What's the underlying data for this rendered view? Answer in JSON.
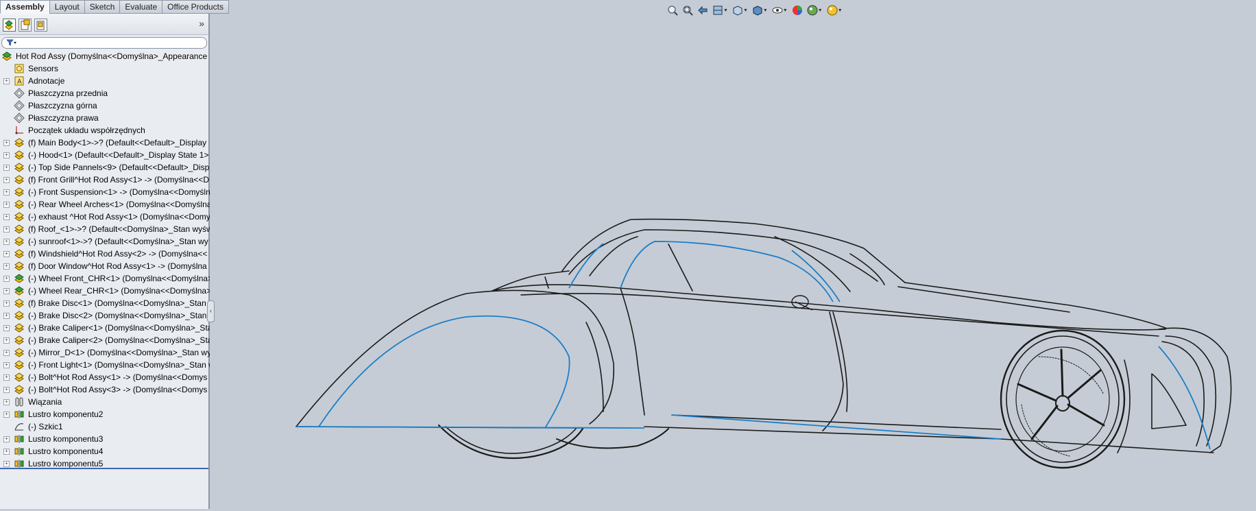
{
  "command_tabs": [
    "Assembly",
    "Layout",
    "Sketch",
    "Evaluate",
    "Office Products"
  ],
  "feature_tree": [
    {
      "label": "Hot Rod Assy  (Domyślna<<Domyślna>_Appearance D",
      "icon": "assembly-icon",
      "expand": false,
      "root": true
    },
    {
      "label": "Sensors",
      "icon": "sensors-icon",
      "expand": false
    },
    {
      "label": "Adnotacje",
      "icon": "annotations-icon",
      "expand": true
    },
    {
      "label": "Płaszczyzna przednia",
      "icon": "plane-icon",
      "expand": false
    },
    {
      "label": "Płaszczyzna górna",
      "icon": "plane-icon",
      "expand": false
    },
    {
      "label": "Płaszczyzna prawa",
      "icon": "plane-icon",
      "expand": false
    },
    {
      "label": "Początek układu współrzędnych",
      "icon": "origin-icon",
      "expand": false
    },
    {
      "label": "(f) Main Body<1>->? (Default<<Default>_Display",
      "icon": "subassembly-icon",
      "expand": true
    },
    {
      "label": "(-) Hood<1> (Default<<Default>_Display State 1>",
      "icon": "subassembly-icon",
      "expand": true
    },
    {
      "label": "(-) Top Side Pannels<9> (Default<<Default>_Displ",
      "icon": "subassembly-icon",
      "expand": true
    },
    {
      "label": "(f) Front Grill^Hot Rod Assy<1> -> (Domyślna<<D",
      "icon": "subassembly-icon",
      "expand": true
    },
    {
      "label": "(-) Front Suspension<1> -> (Domyślna<<Domyśln",
      "icon": "subassembly-icon",
      "expand": true
    },
    {
      "label": "(-) Rear Wheel Arches<1> (Domyślna<<Domyślna",
      "icon": "subassembly-icon",
      "expand": true
    },
    {
      "label": "(-) exhaust ^Hot Rod Assy<1> (Domyślna<<Domy",
      "icon": "subassembly-icon",
      "expand": true
    },
    {
      "label": "(f) Roof_<1>->? (Default<<Domyślna>_Stan wyśw",
      "icon": "subassembly-icon",
      "expand": true
    },
    {
      "label": "(-) sunroof<1>->? (Default<<Domyślna>_Stan wy",
      "icon": "subassembly-icon",
      "expand": true
    },
    {
      "label": "(f) Windshield^Hot Rod Assy<2> -> (Domyślna<<",
      "icon": "subassembly-icon",
      "expand": true
    },
    {
      "label": "(f) Door Window^Hot Rod Assy<1> -> (Domyślna",
      "icon": "subassembly-icon",
      "expand": true
    },
    {
      "label": "(-) Wheel Front_CHR<1> (Domyślna<<Domyślna>",
      "icon": "wheel-assembly-icon",
      "expand": true
    },
    {
      "label": "(-) Wheel Rear_CHR<1> (Domyślna<<Domyślna>_",
      "icon": "wheel-assembly-icon",
      "expand": true
    },
    {
      "label": "(f) Brake Disc<1> (Domyślna<<Domyślna>_Stan w",
      "icon": "subassembly-icon",
      "expand": true
    },
    {
      "label": "(-) Brake Disc<2> (Domyślna<<Domyślna>_Stan w",
      "icon": "subassembly-icon",
      "expand": true
    },
    {
      "label": "(-) Brake Caliper<1> (Domyślna<<Domyślna>_Sta",
      "icon": "subassembly-icon",
      "expand": true
    },
    {
      "label": "(-) Brake Caliper<2> (Domyślna<<Domyślna>_Sta",
      "icon": "subassembly-icon",
      "expand": true
    },
    {
      "label": "(-) Mirror_D<1> (Domyślna<<Domyślna>_Stan wy",
      "icon": "subassembly-icon",
      "expand": true
    },
    {
      "label": "(-) Front Light<1> (Domyślna<<Domyślna>_Stan w",
      "icon": "subassembly-icon",
      "expand": true
    },
    {
      "label": "(-) Bolt^Hot Rod Assy<1> -> (Domyślna<<Domys",
      "icon": "subassembly-icon",
      "expand": true
    },
    {
      "label": "(-) Bolt^Hot Rod Assy<3> -> (Domyślna<<Domys",
      "icon": "subassembly-icon",
      "expand": true
    },
    {
      "label": "Wiązania",
      "icon": "mates-icon",
      "expand": true
    },
    {
      "label": "Lustro komponentu2",
      "icon": "mirror-component-icon",
      "expand": true
    },
    {
      "label": "(-) Szkic1",
      "icon": "sketch-icon",
      "expand": false
    },
    {
      "label": "Lustro komponentu3",
      "icon": "mirror-component-icon",
      "expand": true
    },
    {
      "label": "Lustro komponentu4",
      "icon": "mirror-component-icon",
      "expand": true
    },
    {
      "label": "Lustro komponentu5",
      "icon": "mirror-component-icon",
      "expand": true
    }
  ],
  "heads_up_toolbar": [
    "zoom-to-fit-icon",
    "zoom-to-area-icon",
    "previous-view-icon",
    "section-view-icon",
    "view-orientation-icon",
    "display-style-icon",
    "hide-show-items-icon",
    "edit-appearance-icon",
    "apply-scene-icon",
    "view-settings-icon"
  ],
  "colors": {
    "viewport_bg": "#c6ccd5",
    "tree_bg": "#e9ecf1",
    "selected_edge": "#1a7fc7",
    "model_line": "#1a1a1a"
  }
}
